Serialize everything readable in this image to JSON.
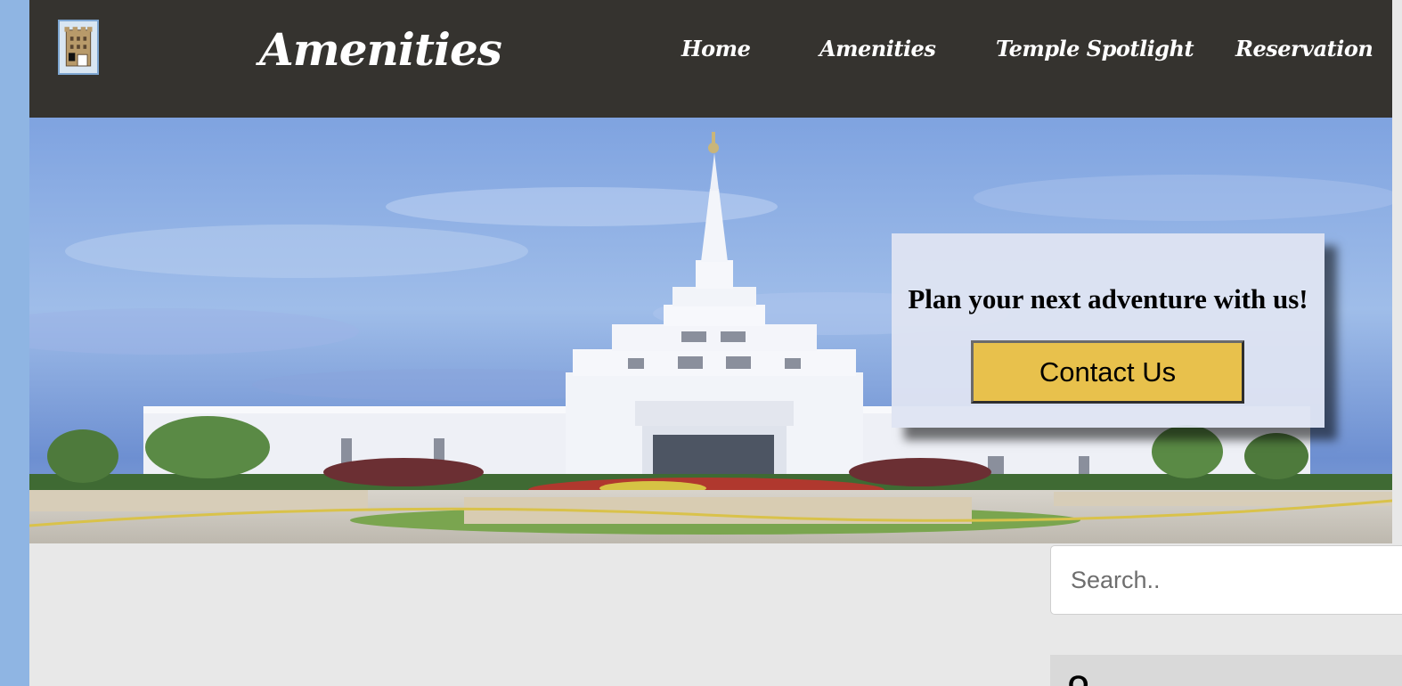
{
  "header": {
    "logo_icon": "castle-tower-icon",
    "title": "Amenities",
    "background_color": "#35332f"
  },
  "nav": {
    "items": [
      {
        "label": "Home"
      },
      {
        "label": "Amenities"
      },
      {
        "label": "Temple Spotlight"
      },
      {
        "label": "Reservation"
      }
    ]
  },
  "hero": {
    "image": "temple-photo",
    "cta": {
      "heading": "Plan your next adventure with us!",
      "button_label": "Contact Us",
      "button_color": "#e8c14c"
    }
  },
  "sidebar": {
    "search": {
      "placeholder": "Search..",
      "value": ""
    },
    "heading": "O"
  },
  "colors": {
    "page_background": "#e8e8e8",
    "outer_background": "#8fb5e3"
  }
}
